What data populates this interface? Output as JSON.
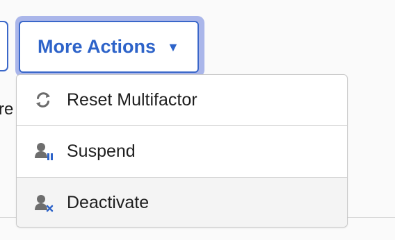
{
  "left_partial_text": "re",
  "more_actions": {
    "label": "More Actions",
    "caret": "▼",
    "icon": "chevron-down-icon",
    "accent_color": "#2d63c9"
  },
  "menu": {
    "items": [
      {
        "label": "Reset Multifactor",
        "icon": "refresh-icon"
      },
      {
        "label": "Suspend",
        "icon": "user-pause-icon"
      },
      {
        "label": "Deactivate",
        "icon": "user-x-icon"
      }
    ]
  }
}
